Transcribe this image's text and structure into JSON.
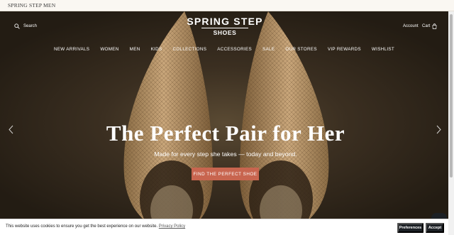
{
  "announcement": "SPRING STEP MEN",
  "header": {
    "search_label": "Search",
    "logo_main": "SPRING STEP",
    "logo_sub": "SHOES",
    "account_label": "Account",
    "cart_label": "Cart"
  },
  "nav": {
    "items": [
      {
        "label": "NEW ARRIVALS"
      },
      {
        "label": "WOMEN"
      },
      {
        "label": "MEN"
      },
      {
        "label": "KIDS"
      },
      {
        "label": "COLLECTIONS"
      },
      {
        "label": "ACCESSORIES"
      },
      {
        "label": "SALE"
      },
      {
        "label": "OUR STORES"
      },
      {
        "label": "VIP REWARDS"
      },
      {
        "label": "WISHLIST"
      }
    ]
  },
  "hero": {
    "title": "The Perfect Pair for Her",
    "subtitle": "Made for every step she takes — today and beyond.",
    "cta_label": "FIND THE PERFECT SHOE"
  },
  "cookie": {
    "text": "This website uses cookies to ensure you get the best experience on our website. ",
    "link_label": "Privacy Policy",
    "preferences_label": "Preferences",
    "accept_label": "Accept"
  },
  "colors": {
    "cta": "#c8654f",
    "dark_button": "#1c2025",
    "announcement_bg": "#faf7f2"
  }
}
